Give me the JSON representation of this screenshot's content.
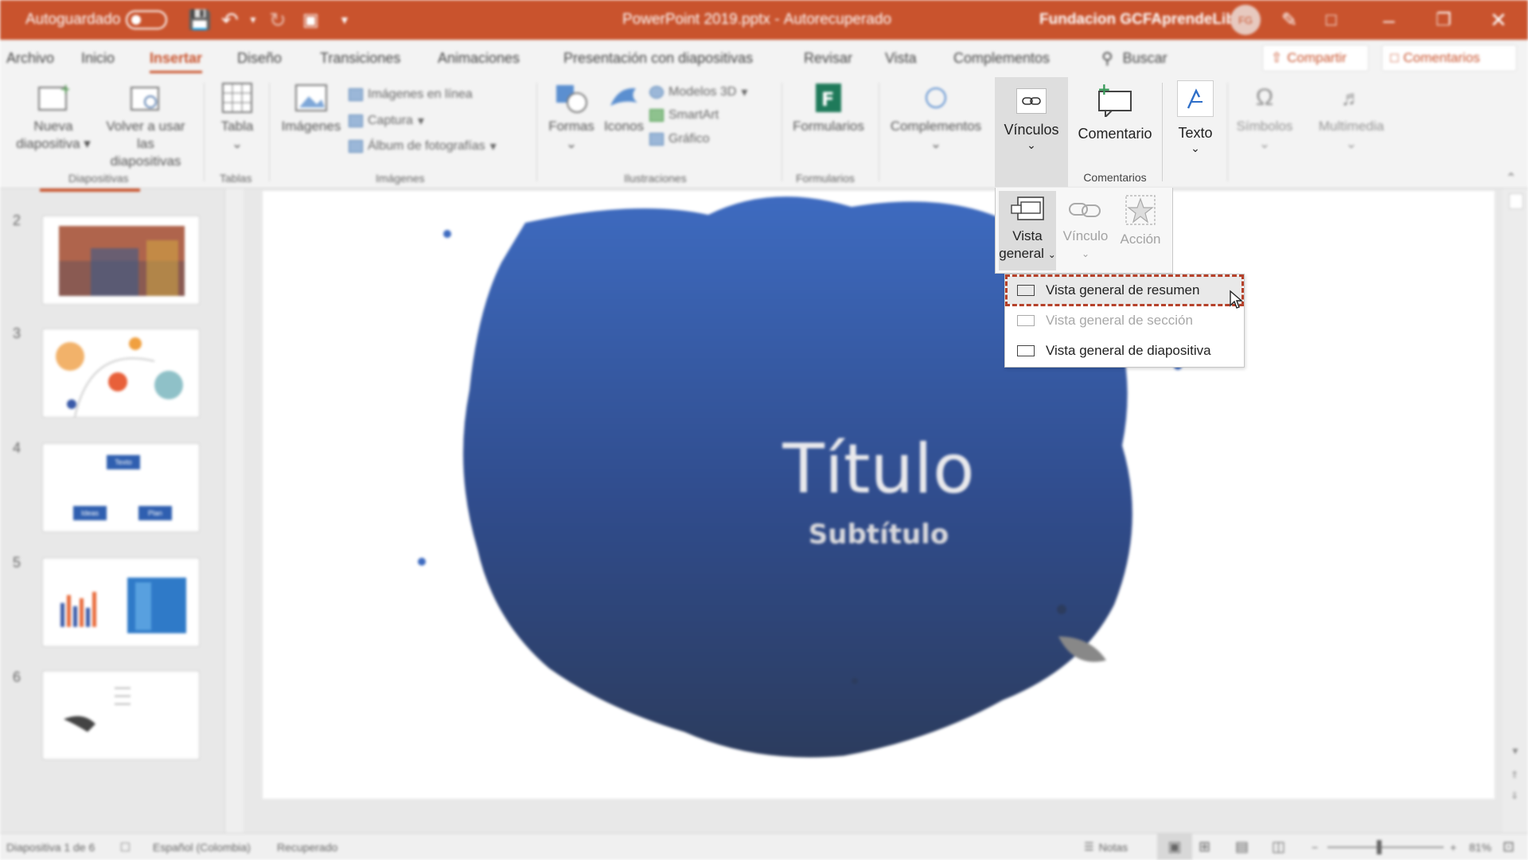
{
  "titlebar": {
    "autosave_label": "Autoguardado",
    "file_title": "PowerPoint 2019.pptx",
    "separator": "-",
    "recovered_label": "Autorecuperado",
    "account": "Fundacion GCFAprendeLibre",
    "avatar_initials": "FG",
    "bg_color": "#c9532d"
  },
  "tabs": [
    {
      "label": "Archivo"
    },
    {
      "label": "Inicio"
    },
    {
      "label": "Insertar",
      "active": true
    },
    {
      "label": "Diseño"
    },
    {
      "label": "Transiciones"
    },
    {
      "label": "Animaciones"
    },
    {
      "label": "Presentación con diapositivas"
    },
    {
      "label": "Revisar"
    },
    {
      "label": "Vista"
    },
    {
      "label": "Complementos"
    }
  ],
  "search": {
    "label": "Buscar"
  },
  "share": {
    "label": "Compartir"
  },
  "comments_top": {
    "label": "Comentarios"
  },
  "ribbon": {
    "nueva_line1": "Nueva",
    "nueva_line2": "diapositiva",
    "volver_line1": "Volver a usar",
    "volver_line2": "las diapositivas",
    "diapositivas_group": "Diapositivas",
    "tabla": "Tabla",
    "tablas_group": "Tablas",
    "imagenes": "Imágenes",
    "imagenes_linea": "Imágenes en línea",
    "captura": "Captura",
    "album": "Álbum de fotografías",
    "imagenes_group": "Imágenes",
    "formas": "Formas",
    "iconos": "Iconos",
    "modelos3d": "Modelos 3D",
    "smartart": "SmartArt",
    "grafico": "Gráfico",
    "ilustraciones_group": "Ilustraciones",
    "formularios": "Formularios",
    "formularios_group": "Formularios",
    "complementos": "Complementos",
    "vinculos": "Vínculos",
    "comentario": "Comentario",
    "comentarios_group": "Comentarios",
    "texto": "Texto",
    "simbolos": "Símbolos",
    "multimedia": "Multimedia"
  },
  "vinculos_panel": {
    "vista_line1": "Vista",
    "vista_line2": "general",
    "vinculo": "Vínculo",
    "accion": "Acción"
  },
  "menu": {
    "items": [
      {
        "label": "Vista general de resumen",
        "state": "highlighted"
      },
      {
        "label": "Vista general de sección",
        "state": "disabled"
      },
      {
        "label": "Vista general de diapositiva",
        "state": "enabled"
      }
    ]
  },
  "thumbnails": [
    {
      "number": "2"
    },
    {
      "number": "3"
    },
    {
      "number": "4",
      "top_box": "Texto",
      "left_box": "Ideas",
      "right_box": "Plan"
    },
    {
      "number": "5"
    },
    {
      "number": "6"
    }
  ],
  "slide": {
    "title": "Título",
    "subtitle": "Subtítulo"
  },
  "status": {
    "slide_info": "Diapositiva 1 de 6",
    "language": "Español (Colombia)",
    "state": "Recuperado",
    "notes": "Notas",
    "zoom": "81%"
  }
}
